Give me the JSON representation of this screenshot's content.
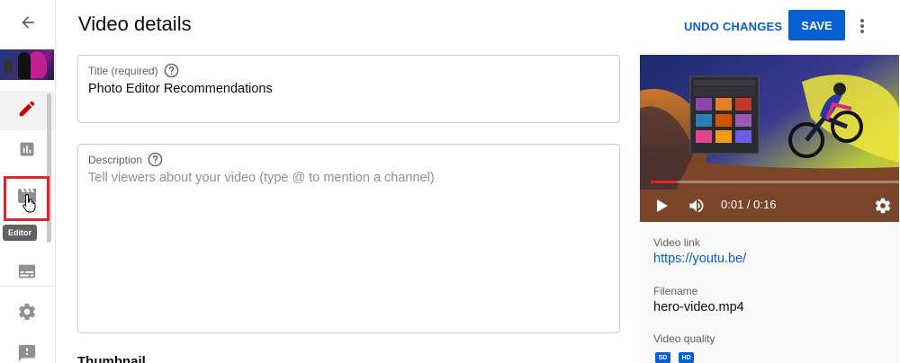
{
  "header": {
    "title": "Video details",
    "undo_label": "UNDO CHANGES",
    "save_label": "SAVE"
  },
  "rail": {
    "items": [
      {
        "icon": "pencil-icon",
        "active": true
      },
      {
        "icon": "analytics-icon"
      },
      {
        "icon": "editor-icon",
        "tooltip": "Editor"
      },
      {
        "icon": "subtitles-icon"
      },
      {
        "icon": "settings-icon"
      },
      {
        "icon": "feedback-icon"
      }
    ]
  },
  "form": {
    "title_label": "Title (required)",
    "title_value": "Photo Editor Recommendations",
    "description_label": "Description",
    "description_placeholder": "Tell viewers about your video (type @ to mention a channel)",
    "thumbnail_heading": "Thumbnail"
  },
  "player": {
    "time": "0:01 / 0:16",
    "progress": 0.104
  },
  "details": {
    "video_link_label": "Video link",
    "video_link": "https://youtu.be/",
    "filename_label": "Filename",
    "filename": "hero-video.mp4",
    "quality_label": "Video quality",
    "quality_badges": [
      "SD",
      "HD"
    ]
  },
  "colors": {
    "accent": "#065fd4",
    "highlight": "#e0252d",
    "progress": "#e52222"
  }
}
